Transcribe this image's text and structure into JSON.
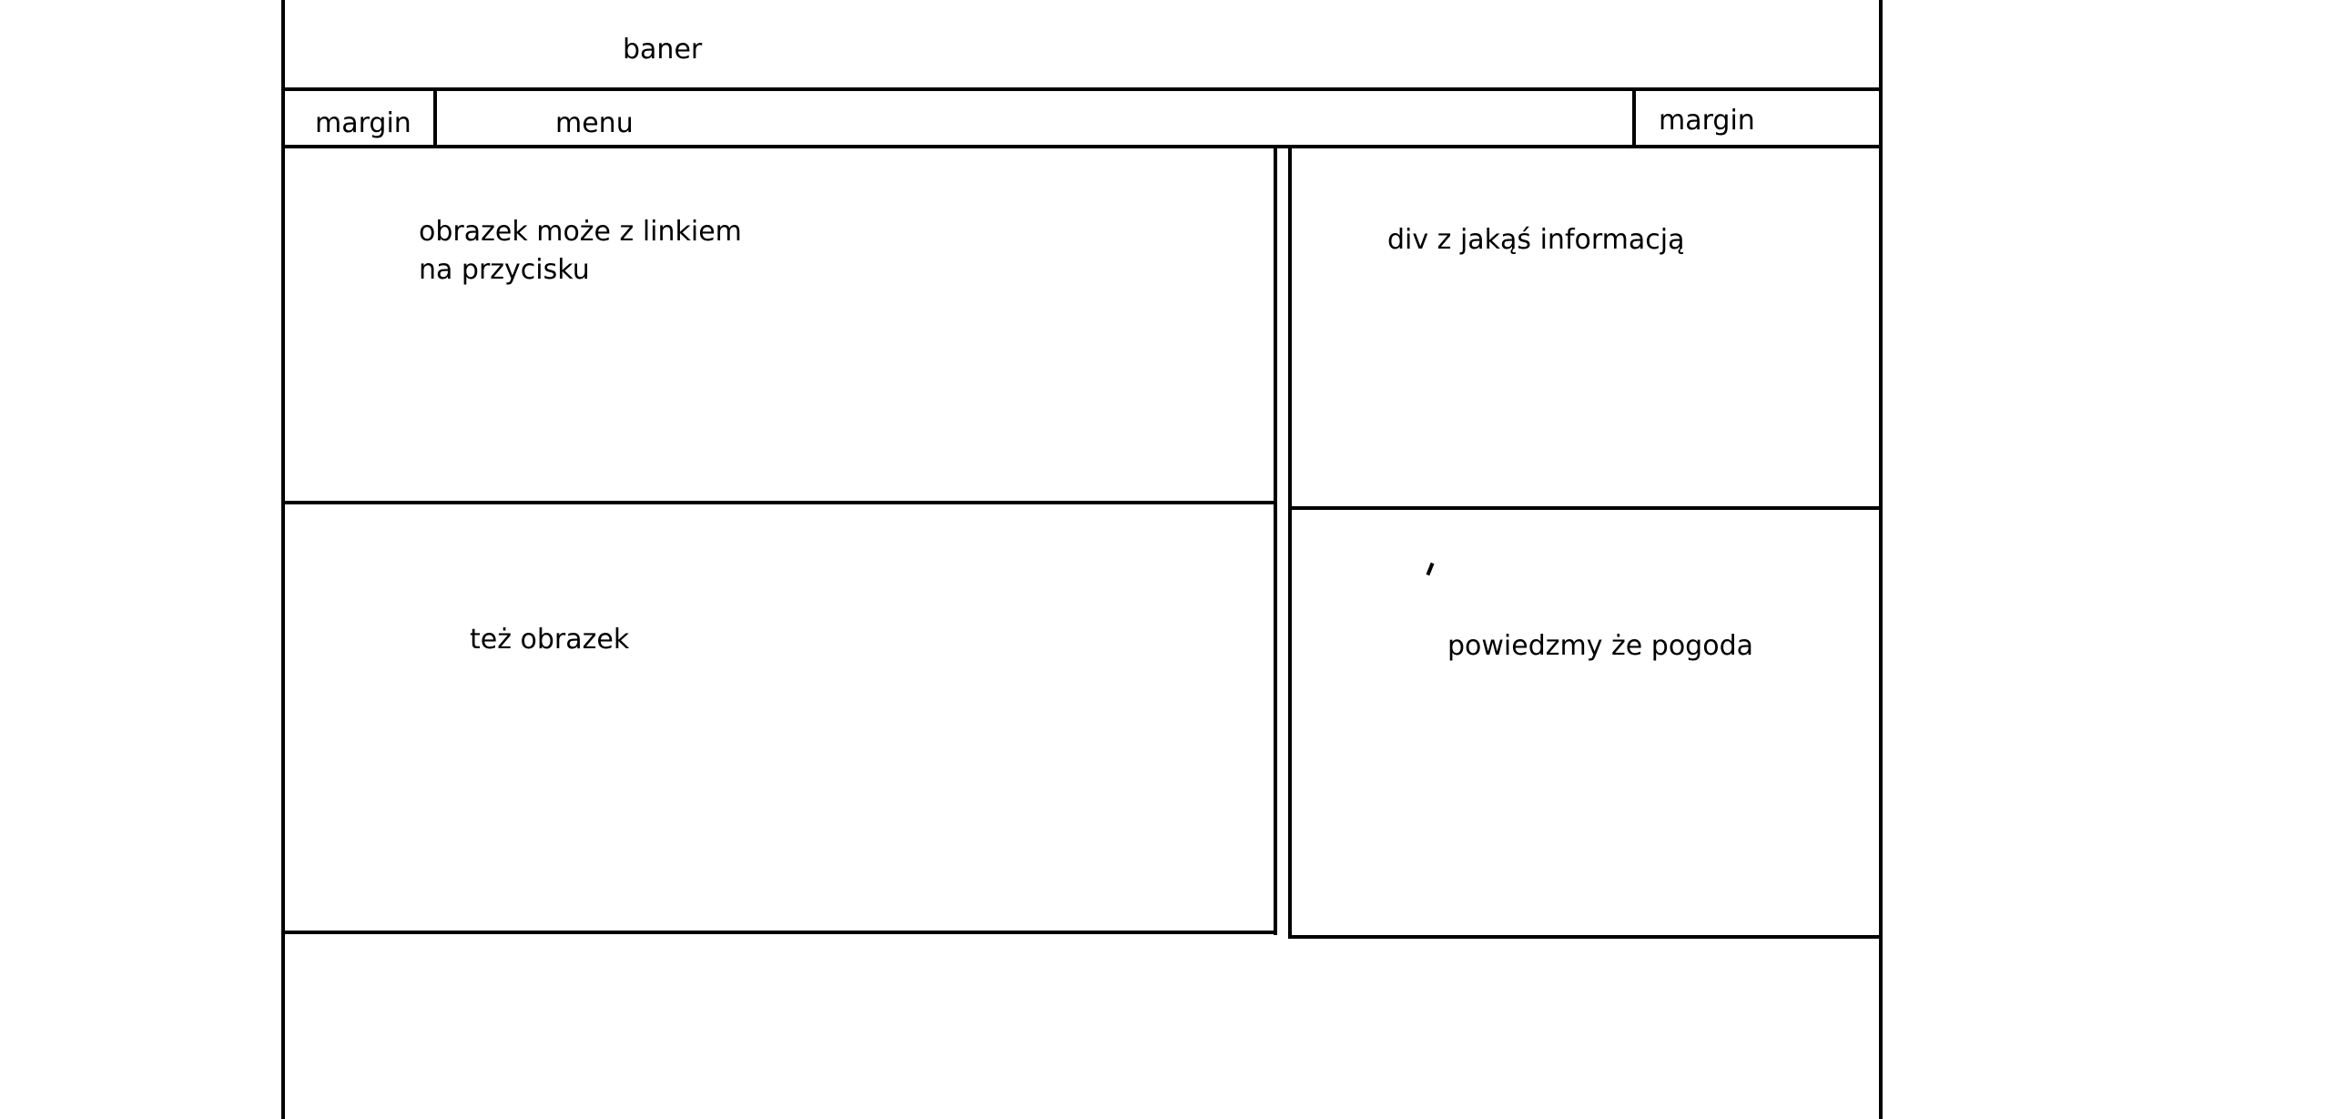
{
  "diagram": {
    "banner_label": "baner",
    "margin_left_label": "margin",
    "menu_label": "menu",
    "margin_right_label": "margin",
    "image_link_label": [
      "obrazek może z linkiem",
      "na przycisku"
    ],
    "info_div_label": "div z jakąś informacją",
    "second_image_label": "też obrazek",
    "weather_label": "powiedzmy że pogoda"
  }
}
